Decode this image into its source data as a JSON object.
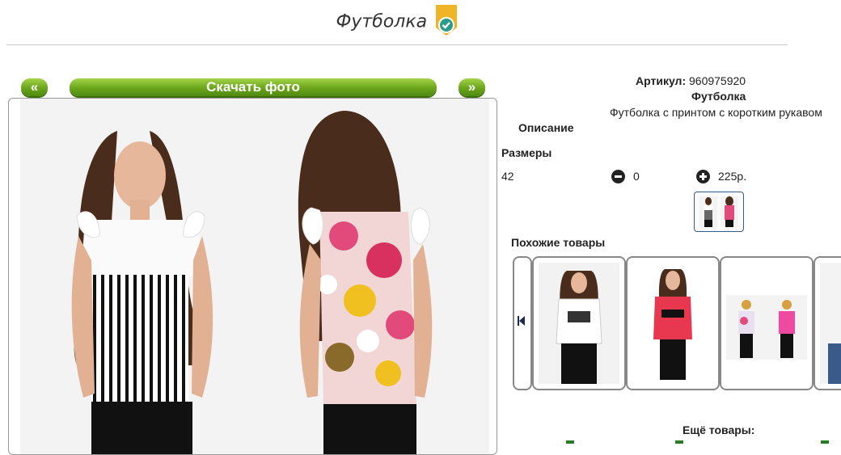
{
  "header": {
    "title": "Футболка",
    "badge_icon": "verified-check-icon",
    "badge_color": "#f0b429"
  },
  "gallery": {
    "prev_label": "«",
    "download_label": "Скачать фото",
    "next_label": "»",
    "accent_color": "#6aa51b"
  },
  "product": {
    "article_label": "Артикул:",
    "article_value": "960975920",
    "name": "Футболка",
    "description": "Футболка с принтом с коротким рукавом",
    "description_label": "Описание",
    "sizes_label": "Размеры",
    "sizes": [
      {
        "size": "42",
        "qty": "0",
        "price": "225р."
      }
    ]
  },
  "similar": {
    "label": "Похожие товары",
    "items": [
      {
        "name": "white-tshirt"
      },
      {
        "name": "red-tshirt"
      },
      {
        "name": "pink-tshirt"
      },
      {
        "name": "partial-item"
      }
    ]
  },
  "more": {
    "label": "Ещё товары:"
  }
}
